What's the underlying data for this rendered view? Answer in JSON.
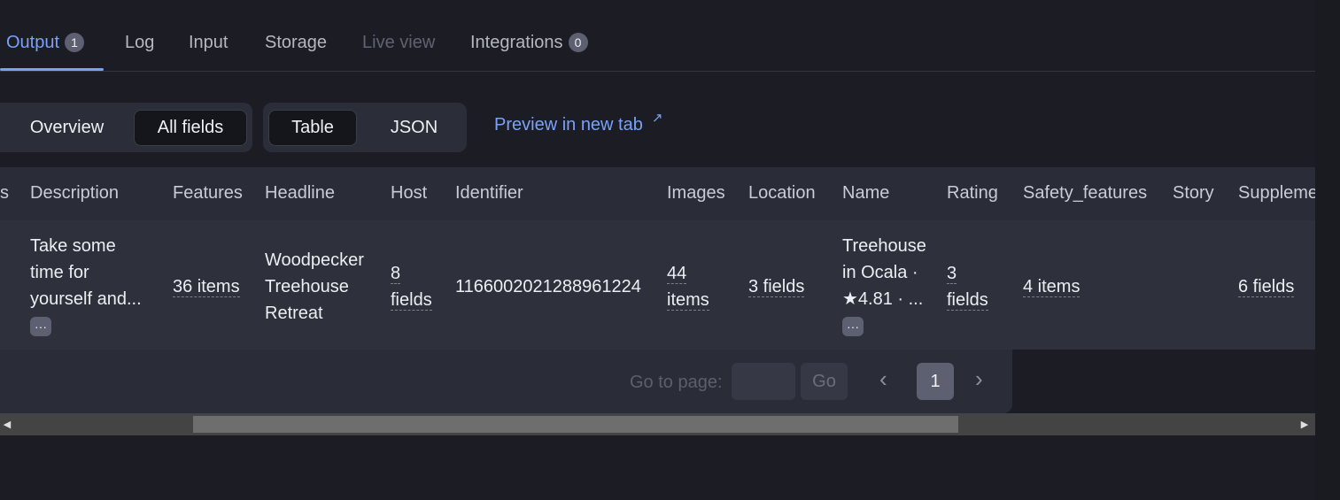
{
  "tabs": [
    {
      "label": "Output",
      "badge": "1"
    },
    {
      "label": "Log"
    },
    {
      "label": "Input"
    },
    {
      "label": "Storage"
    },
    {
      "label": "Live view"
    },
    {
      "label": "Integrations",
      "badge": "0"
    }
  ],
  "view_toggle": {
    "overview": "Overview",
    "all_fields": "All fields"
  },
  "format_toggle": {
    "table": "Table",
    "json": "JSON"
  },
  "preview_link": {
    "label": "Preview in new tab",
    "icon": "external-link-icon"
  },
  "table": {
    "columns": [
      "s",
      "Description",
      "Features",
      "Headline",
      "Host",
      "Identifier",
      "Images",
      "Location",
      "Name",
      "Rating",
      "Safety_features",
      "Story",
      "Suppleme"
    ],
    "row": {
      "description_lines": [
        "Take some",
        "time for",
        "yourself and..."
      ],
      "features": "36 items",
      "headline_lines": [
        "Woodpecker",
        "Treehouse",
        "Retreat"
      ],
      "host_lines": [
        "8",
        "fields"
      ],
      "identifier": "1166002021288961224",
      "images_lines": [
        "44",
        "items"
      ],
      "location": "3 fields",
      "name_lines": [
        "Treehouse",
        "in Ocala ·",
        "★4.81 · ..."
      ],
      "rating_lines": [
        "3",
        "fields"
      ],
      "safety_features": "4 items",
      "supplementary": "6 fields",
      "more_label": "···"
    }
  },
  "pagination": {
    "goto_label": "Go to page:",
    "go_button": "Go",
    "current_page": "1",
    "prev_icon": "chevron-left-icon",
    "next_icon": "chevron-right-icon"
  }
}
